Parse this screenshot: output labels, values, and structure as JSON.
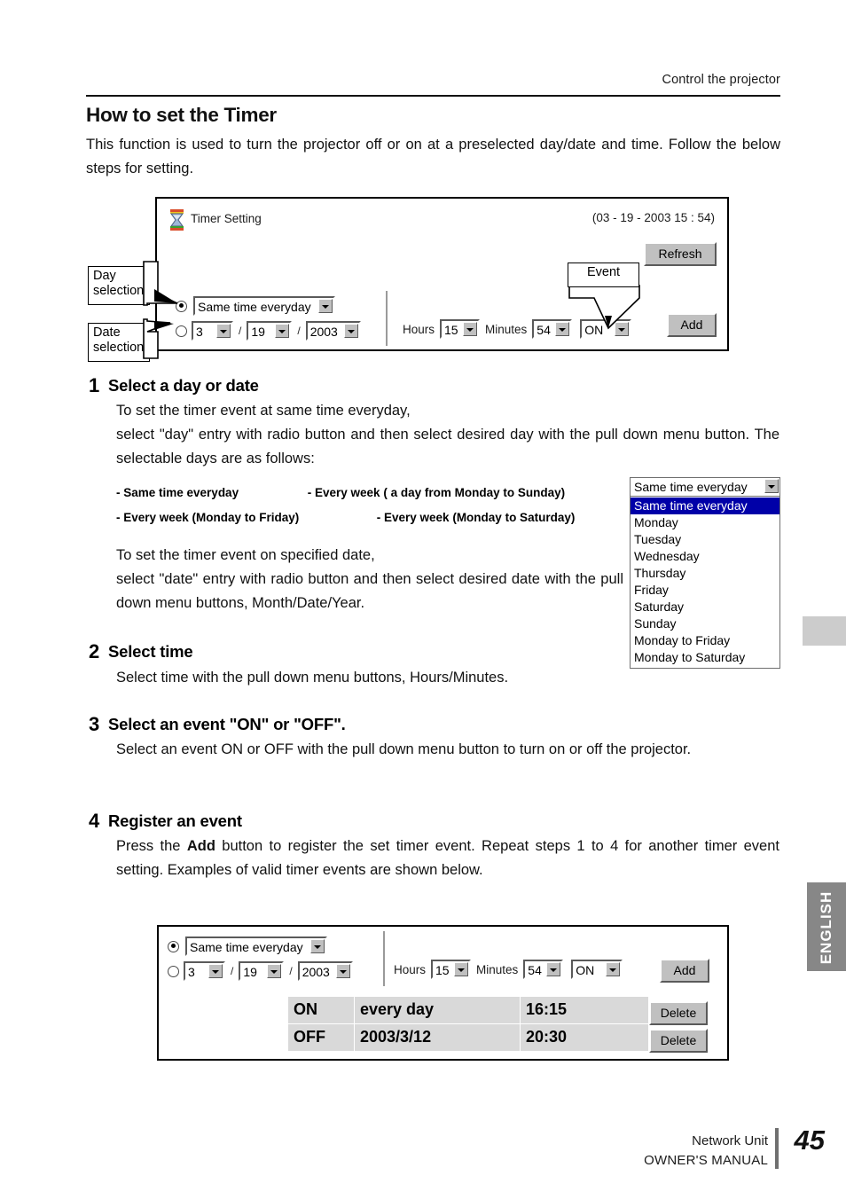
{
  "header": {
    "running_head": "Control the projector"
  },
  "title": "How to set the Timer",
  "intro": "This function is used to turn the projector off or on at a preselected day/date and time. Follow the below steps for setting.",
  "screenshot1": {
    "icon": "hourglass-icon",
    "title": "Timer Setting",
    "clock": "(03 - 19 - 2003 15 : 54)",
    "refresh_label": "Refresh",
    "add_label": "Add",
    "day_select_value": "Same time everyday",
    "date_month": "3",
    "date_day": "19",
    "date_year": "2003",
    "slash": "/",
    "hours_label": "Hours",
    "hours_value": "15",
    "minutes_label": "Minutes",
    "minutes_value": "54",
    "event_value": "ON",
    "callout_day": "Day\nselection",
    "callout_day_line1": "Day",
    "callout_day_line2": "selection",
    "callout_date_line1": "Date",
    "callout_date_line2": "selection",
    "callout_event": "Event"
  },
  "steps": [
    {
      "number": "1",
      "heading": "Select a day or date",
      "para1": "To set the timer event at same time everyday,",
      "para2": "select \"day\" entry with radio button and then select desired day with the pull down menu button. The selectable days are as follows:",
      "day_options": [
        "- Same time everyday",
        "- Every week ( a day from Monday to Sunday)",
        "- Every week (Monday to Friday)",
        "- Every week (Monday to Saturday)"
      ],
      "para3": "To set the timer event on specified date,",
      "para4": "select \"date\" entry with radio button and then select desired date with the pull down menu buttons, Month/Date/Year."
    },
    {
      "number": "2",
      "heading": "Select time",
      "para1": "Select time with the pull down menu buttons, Hours/Minutes."
    },
    {
      "number": "3",
      "heading": "Select an event \"ON\" or \"OFF\".",
      "para1_a": "Select an event ",
      "para1_on": "ON",
      "para1_b": " or ",
      "para1_off": "OFF",
      "para1_c": " with the pull down menu button to turn on or off the projector."
    },
    {
      "number": "4",
      "heading": "Register an event",
      "para1_a": "Press the ",
      "para1_add": "Add",
      "para1_b": " button to register the set timer event. Repeat steps 1 to 4 for another timer event setting. Examples of valid timer events are shown below."
    }
  ],
  "dropdown": {
    "selected": "Same time everyday",
    "options": [
      "Same time everyday",
      "Monday",
      "Tuesday",
      "Wednesday",
      "Thursday",
      "Friday",
      "Saturday",
      "Sunday",
      "Monday to Friday",
      "Monday to Saturday"
    ],
    "highlight_color": "#0000a8"
  },
  "screenshot2": {
    "day_select_value": "Same time everyday",
    "date_month": "3",
    "date_day": "19",
    "date_year": "2003",
    "slash": "/",
    "hours_label": "Hours",
    "hours_value": "15",
    "minutes_label": "Minutes",
    "minutes_value": "54",
    "event_value": "ON",
    "add_label": "Add",
    "delete_label": "Delete",
    "events": [
      {
        "type": "ON",
        "when": "every day",
        "time": "16:15",
        "delete_label": "Delete"
      },
      {
        "type": "OFF",
        "when": "2003/3/12",
        "time": "20:30",
        "delete_label": "Delete"
      }
    ]
  },
  "side_tab": {
    "language": "ENGLISH"
  },
  "footer": {
    "line1": "Network Unit",
    "line2": "OWNER'S MANUAL",
    "page": "45"
  }
}
